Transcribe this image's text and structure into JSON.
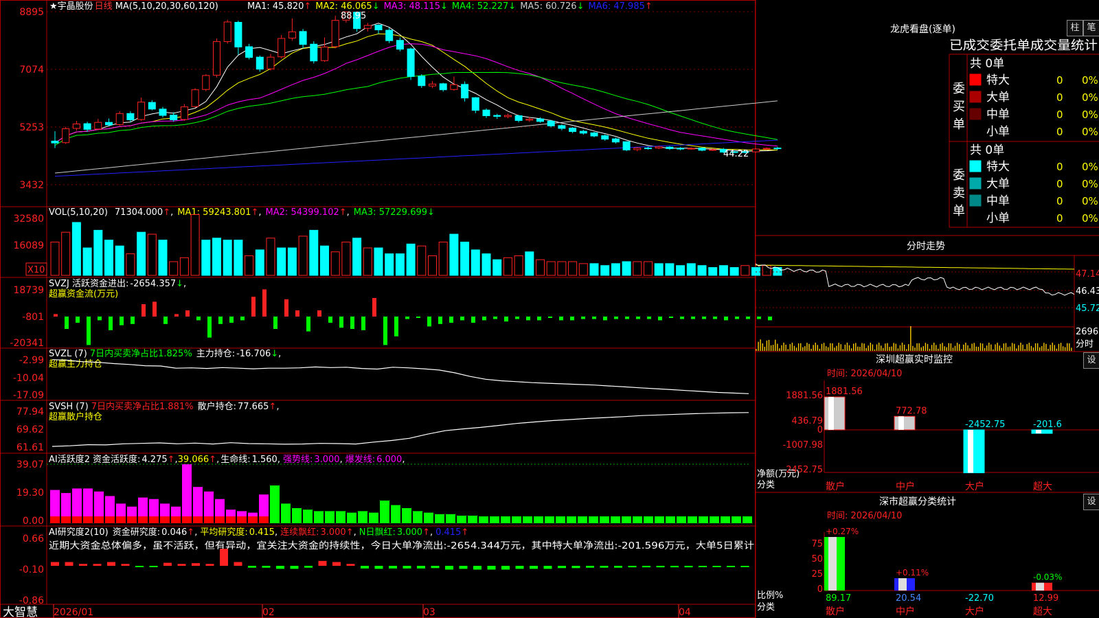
{
  "app": {
    "brand": "大智慧",
    "stock_name": "宇晶股份",
    "period": "日线"
  },
  "main_panel": {
    "ma_label": "MA(5,10,20,30,60,120)",
    "ma_values": [
      {
        "name": "MA1:",
        "value": "45.820",
        "arrow": "↑",
        "color": "#ffffff"
      },
      {
        "name": "MA2:",
        "value": "46.065",
        "arrow": "↓",
        "color": "#ffff00"
      },
      {
        "name": "MA3:",
        "value": "48.115",
        "arrow": "↓",
        "color": "#ff00ff"
      },
      {
        "name": "MA4:",
        "value": "52.227",
        "arrow": "↓",
        "color": "#00ff00"
      },
      {
        "name": "MA5:",
        "value": "60.726",
        "arrow": "↓",
        "color": "#cccccc"
      },
      {
        "name": "MA6:",
        "value": "47.985",
        "arrow": "↑",
        "color": "#2222ff"
      }
    ],
    "y_ticks": [
      "8895",
      "7074",
      "5253",
      "3432"
    ],
    "high_label": "88.95",
    "low_label": "44.22"
  },
  "vol_panel": {
    "label": "VOL(5,10,20)",
    "value": "71304.000",
    "ma1": "59243.801",
    "ma2": "54399.102",
    "ma3": "57229.699",
    "y_ticks": [
      "32580",
      "16089"
    ],
    "unit": "X10"
  },
  "svzj_panel": {
    "label": "SVZJ  活跃资金进出:",
    "value": "-2654.357",
    "sub": "超赢资金流(万元)",
    "y_ticks": [
      "18739",
      "-801",
      "-20341"
    ]
  },
  "svzl_panel": {
    "label": "SVZL (7)",
    "pct": "7日内买卖净占比1.825%",
    "hold_label": "主力持仓:",
    "hold_value": "-16.706",
    "sub": "超赢主力持仓",
    "y_ticks": [
      "-2.99",
      "-10.04",
      "-17.09"
    ]
  },
  "svsh_panel": {
    "label": "SVSH (7)",
    "pct": "7日内买卖净占比1.881%",
    "hold_label": "散户持仓:",
    "hold_value": "77.665",
    "sub": "超赢散户持仓",
    "y_ticks": [
      "77.94",
      "69.62",
      "61.61"
    ]
  },
  "ai_active": {
    "label": "AI活跃度2",
    "v1_label": "资金活跃度:",
    "v1": "4.275",
    "v2": "39.066",
    "v3_label": "生命线:",
    "v3": "1.560",
    "v4_label": "强势线:",
    "v4": "3.000",
    "v5_label": "爆发线:",
    "v5": "6.000",
    "y_ticks": [
      "39.07",
      "19.30",
      "0.00"
    ]
  },
  "ai_research": {
    "label": "AI研究度2(10)",
    "v1_label": "资金研究度:",
    "v1": "0.046",
    "v2_label": "平均研究度:",
    "v2": "0.415",
    "v3_label": "连续飘红:",
    "v3": "3.000",
    "v4_label": "N日飘红:",
    "v4": "3.000",
    "v5": "0.415",
    "comment": "近期大资金总体偏多，虽不活跃，但有异动，宜关注大资金的持续性，今日大单净流出:-2654.344万元，其中特大单净流出:-201.596万元，大单5日累计",
    "y_ticks": [
      "0.66",
      "-0.10",
      "-0.86"
    ]
  },
  "x_axis": [
    "2026/01",
    "02",
    "03",
    "04"
  ],
  "dragon_tiger": {
    "title": "龙虎看盘(逐单)",
    "btn1": "柱",
    "btn2": "笔",
    "header": "已成交委托单成交量统计",
    "buy": {
      "side_label": "委买单",
      "total": "共 0单",
      "rows": [
        {
          "name": "特大",
          "count": "0",
          "pct": "0%",
          "color": "#ff0000"
        },
        {
          "name": "大单",
          "count": "0",
          "pct": "0%",
          "color": "#aa0000"
        },
        {
          "name": "中单",
          "count": "0",
          "pct": "0%",
          "color": "#660000"
        },
        {
          "name": "小单",
          "count": "0",
          "pct": "0%",
          "color": "#000000"
        }
      ]
    },
    "sell": {
      "side_label": "委卖单",
      "total": "共 0单",
      "rows": [
        {
          "name": "特大",
          "count": "0",
          "pct": "0%",
          "color": "#00ffff"
        },
        {
          "name": "大单",
          "count": "0",
          "pct": "0%",
          "color": "#00aaaa"
        },
        {
          "name": "中单",
          "count": "0",
          "pct": "0%",
          "color": "#008888"
        },
        {
          "name": "小单",
          "count": "0",
          "pct": "0%",
          "color": "#000000"
        }
      ]
    }
  },
  "intraday": {
    "title": "分时走势",
    "y_ticks": [
      "47.14",
      "46.43",
      "45.72"
    ],
    "vol_tick": "2696",
    "vol_unit": "分时"
  },
  "sz_monitor": {
    "title": "深圳超赢实时监控",
    "btn": "设",
    "time_label": "时间: 2026/04/10",
    "y_ticks": [
      "1881.56",
      "436.79",
      "0",
      "-1007.98",
      "-2452.75"
    ],
    "unit_label": "净额(万元)",
    "cat_label": "分类",
    "categories": [
      "散户",
      "中户",
      "大户",
      "超大"
    ],
    "values": [
      1881.56,
      772.78,
      -2452.75,
      -201.6
    ],
    "value_labels": [
      "1881.56",
      "772.78",
      "-2452.75",
      "-201.6"
    ]
  },
  "sz_class": {
    "title": "深市超赢分类统计",
    "btn": "设",
    "time_label": "时间: 2026/04/10",
    "y_ticks": [
      "75",
      "50",
      "25",
      "0"
    ],
    "unit_label": "比例%",
    "cat_label": "分类",
    "categories": [
      "散户",
      "中户",
      "大户",
      "超大"
    ],
    "top_labels": [
      "+0.27%",
      "+0.11%",
      "",
      "-0.03%"
    ],
    "bottom_values": [
      "89.17",
      "20.54",
      "-22.70",
      "12.99"
    ],
    "bar_pcts": [
      89.17,
      20.54,
      0,
      12.99
    ]
  },
  "chart_data": [
    {
      "type": "candlestick",
      "title": "宇晶股份 日线",
      "x": [
        "2026/01",
        "02",
        "03",
        "04"
      ],
      "ylim": [
        3432,
        8895
      ],
      "annotations": {
        "high": 88.95,
        "low": 44.22
      },
      "ma_series": [
        {
          "name": "MA1",
          "value": 45.82
        },
        {
          "name": "MA2",
          "value": 46.065
        },
        {
          "name": "MA3",
          "value": 48.115
        },
        {
          "name": "MA4",
          "value": 52.227
        },
        {
          "name": "MA5",
          "value": 60.726
        },
        {
          "name": "MA6",
          "value": 47.985
        }
      ],
      "candles": [
        [
          48.1,
          47.5,
          51.2,
          45.9
        ],
        [
          47.6,
          52.0,
          52.6,
          47.2
        ],
        [
          52.1,
          53.5,
          54.5,
          51.4
        ],
        [
          53.6,
          51.8,
          54.2,
          51.0
        ],
        [
          51.9,
          54.0,
          55.1,
          51.6
        ],
        [
          54.0,
          53.2,
          55.2,
          52.8
        ],
        [
          53.3,
          56.8,
          57.5,
          53.0
        ],
        [
          56.8,
          54.8,
          57.5,
          54.1
        ],
        [
          54.9,
          60.4,
          61.8,
          54.5
        ],
        [
          60.3,
          58.2,
          61.0,
          57.8
        ],
        [
          58.2,
          56.2,
          58.9,
          55.6
        ],
        [
          56.3,
          54.8,
          57.2,
          54.2
        ],
        [
          54.9,
          58.9,
          59.8,
          54.5
        ],
        [
          59.0,
          64.3,
          64.8,
          58.7
        ],
        [
          64.4,
          68.8,
          69.2,
          63.9
        ],
        [
          68.9,
          79.5,
          80.5,
          68.2
        ],
        [
          79.5,
          85.7,
          86.4,
          78.9
        ],
        [
          85.6,
          77.8,
          86.1,
          75.4
        ],
        [
          77.9,
          74.5,
          78.8,
          73.9
        ],
        [
          74.6,
          70.8,
          75.1,
          70.0
        ],
        [
          70.9,
          74.6,
          75.6,
          70.4
        ],
        [
          74.7,
          80.5,
          81.6,
          74.2
        ],
        [
          80.6,
          82.6,
          86.8,
          79.8
        ],
        [
          82.7,
          78.6,
          83.5,
          77.4
        ],
        [
          78.7,
          73.4,
          79.6,
          72.6
        ],
        [
          73.5,
          77.8,
          80.8,
          73.1
        ],
        [
          77.9,
          86.2,
          87.7,
          77.4
        ],
        [
          86.3,
          88.9,
          88.95,
          85.5
        ],
        [
          88.8,
          83.6,
          88.9,
          82.6
        ],
        [
          83.7,
          84.6,
          85.4,
          82.7
        ],
        [
          84.7,
          83.2,
          85.0,
          81.9
        ],
        [
          83.1,
          79.8,
          83.9,
          79.0
        ],
        [
          79.9,
          77.1,
          80.8,
          76.4
        ],
        [
          77.2,
          68.5,
          77.6,
          67.4
        ],
        [
          68.6,
          65.6,
          69.2,
          64.9
        ],
        [
          65.5,
          66.1,
          67.0,
          64.8
        ],
        [
          66.2,
          64.3,
          66.5,
          63.7
        ],
        [
          64.4,
          65.9,
          68.5,
          64.0
        ],
        [
          66.0,
          61.7,
          66.9,
          60.6
        ],
        [
          61.8,
          57.8,
          62.0,
          56.9
        ],
        [
          57.9,
          56.1,
          58.4,
          55.4
        ],
        [
          56.2,
          55.9,
          56.7,
          55.1
        ],
        [
          55.8,
          56.2,
          56.8,
          55.3
        ],
        [
          56.1,
          54.6,
          56.4,
          54.0
        ],
        [
          54.7,
          55.0,
          55.7,
          54.2
        ],
        [
          55.1,
          54.3,
          55.6,
          53.9
        ],
        [
          54.4,
          52.9,
          54.8,
          52.4
        ],
        [
          53.0,
          52.1,
          53.4,
          51.5
        ],
        [
          52.2,
          51.1,
          52.5,
          50.6
        ],
        [
          51.2,
          50.6,
          51.7,
          50.1
        ],
        [
          50.7,
          49.7,
          51.0,
          49.3
        ],
        [
          49.8,
          48.7,
          50.2,
          48.2
        ],
        [
          48.8,
          47.8,
          49.2,
          47.3
        ],
        [
          47.9,
          45.3,
          48.0,
          44.9
        ],
        [
          45.4,
          45.9,
          46.2,
          44.9
        ],
        [
          45.9,
          45.8,
          46.3,
          45.4
        ],
        [
          45.9,
          46.3,
          46.6,
          45.6
        ],
        [
          46.2,
          45.7,
          46.5,
          45.3
        ],
        [
          45.8,
          45.6,
          46.2,
          45.2
        ],
        [
          45.7,
          45.8,
          46.1,
          45.4
        ],
        [
          45.9,
          45.2,
          46.1,
          44.9
        ],
        [
          45.3,
          45.4,
          45.8,
          45.0
        ],
        [
          45.5,
          44.6,
          45.9,
          44.3
        ],
        [
          44.7,
          44.6,
          45.0,
          44.3
        ],
        [
          44.7,
          44.6,
          45.1,
          44.22
        ],
        [
          44.7,
          45.6,
          45.8,
          44.5
        ],
        [
          45.7,
          45.8,
          46.1,
          45.3
        ],
        [
          45.9,
          45.8,
          46.3,
          45.4
        ]
      ]
    },
    {
      "type": "bar",
      "title": "VOL(5,10,20)",
      "ylim": [
        0,
        32580
      ],
      "values": [
        17,
        22,
        27,
        14,
        23,
        18,
        15,
        11,
        22,
        21,
        18,
        7,
        9,
        31,
        18,
        19,
        18,
        18,
        10,
        13,
        19,
        14,
        14,
        20,
        23,
        15,
        12,
        17,
        19,
        14,
        14,
        11,
        11,
        16,
        15,
        10,
        17,
        21,
        17,
        13,
        11,
        8,
        9,
        10,
        12,
        8,
        7,
        7,
        7,
        6,
        6,
        5,
        6,
        7,
        7,
        7,
        6,
        6,
        5,
        6,
        5,
        4,
        5,
        4,
        5,
        4,
        5,
        4
      ],
      "colors": [
        "u",
        "u",
        "c",
        "c",
        "c",
        "c",
        "c",
        "u",
        "c",
        "u",
        "c",
        "u",
        "u",
        "u",
        "c",
        "c",
        "c",
        "c",
        "u",
        "c",
        "u",
        "c",
        "c",
        "u",
        "c",
        "c",
        "u",
        "u",
        "c",
        "u",
        "c",
        "c",
        "c",
        "c",
        "u",
        "u",
        "u",
        "c",
        "c",
        "c",
        "c",
        "c",
        "u",
        "u",
        "c",
        "u",
        "u",
        "u",
        "u",
        "u",
        "c",
        "c",
        "c",
        "c",
        "u",
        "u",
        "c",
        "c",
        "c",
        "c",
        "c",
        "c",
        "c",
        "c",
        "u",
        "c",
        "u",
        "c"
      ]
    },
    {
      "type": "bar",
      "title": "SVZJ 活跃资金进出",
      "ylim": [
        -20341,
        18739
      ],
      "values": [
        0.2,
        -1,
        -0.5,
        -2.3,
        -0.3,
        -1.1,
        -0.7,
        -0.6,
        1.0,
        1.2,
        -0.6,
        0.2,
        0.5,
        -0.3,
        -1.7,
        -0.6,
        -0.5,
        -0.3,
        1.6,
        2.2,
        -1.0,
        1.4,
        0.5,
        -1.2,
        0.5,
        -0.5,
        -0.9,
        -1.0,
        -1.1,
        1.5,
        -2.3,
        -1.6,
        -0.2,
        -0.1,
        -0.8,
        -0.6,
        -0.5,
        -0.3,
        -0.5,
        -0.3,
        -0.2,
        -0.4,
        -0.2,
        -0.3,
        -0.3,
        -0.1,
        -0.3,
        -0.3,
        -0.2,
        -0.2,
        -0.3,
        -0.2,
        -0.2,
        -0.2,
        -0.2,
        -0.3,
        -0.1,
        -0.2,
        -0.2,
        -0.2,
        -0.2,
        -0.3,
        -0.2,
        -0.2,
        -0.2,
        -0.3
      ]
    },
    {
      "type": "line",
      "title": "SVZL 主力持仓",
      "ylim": [
        -17.09,
        -2.99
      ],
      "values": [
        -5.6,
        -5.8,
        -6.3,
        -6.5,
        -6.9,
        -7.2,
        -7.6,
        -7.7,
        -8.4,
        -8.3,
        -8.5,
        -8.2,
        -8.4,
        -8.6,
        -8.4,
        -8.4,
        -8.3,
        -8.0,
        -8.2,
        -8.1,
        -8.5,
        -8.7,
        -8.1,
        -8.3,
        -8.6,
        -9.0,
        -9.9,
        -11.1,
        -12.0,
        -12.5,
        -12.8,
        -13.1,
        -13.3,
        -13.5,
        -13.7,
        -13.9,
        -14.2,
        -14.5,
        -14.8,
        -15.1,
        -15.4,
        -15.7,
        -16.0,
        -16.3,
        -16.5,
        -16.7
      ]
    },
    {
      "type": "line",
      "title": "SVSH 散户持仓",
      "ylim": [
        61.61,
        77.94
      ],
      "values": [
        62.2,
        62.5,
        63.0,
        62.9,
        63.4,
        63.6,
        63.8,
        63.4,
        63.7,
        63.3,
        63.9,
        63.5,
        63.4,
        63.2,
        63.3,
        63.6,
        63.5,
        63.3,
        64.2,
        64.9,
        65.9,
        67.8,
        69.4,
        70.2,
        70.9,
        71.8,
        72.7,
        73.4,
        74.0,
        74.5,
        75.0,
        75.4,
        75.8,
        76.3,
        76.6,
        76.9,
        77.2,
        77.4,
        77.6,
        77.7
      ]
    },
    {
      "type": "bar",
      "title": "AI活跃度2",
      "ylim": [
        0,
        39.07
      ],
      "values": [
        22,
        20,
        23,
        23,
        21,
        18,
        13,
        11,
        17,
        16,
        13,
        11,
        39,
        24,
        21,
        16,
        9,
        8,
        7,
        19,
        25,
        13,
        10,
        9,
        8,
        8,
        8,
        7,
        8,
        7,
        15,
        12,
        10,
        8,
        7,
        6,
        6,
        5,
        5,
        4,
        4,
        3,
        3,
        3,
        3,
        3,
        3,
        3,
        3,
        3,
        3,
        3,
        3,
        3,
        3,
        3,
        3,
        3,
        3,
        3,
        3,
        3,
        3,
        3
      ]
    },
    {
      "type": "bar",
      "title": "AI研究度2(10)",
      "ylim": [
        -0.86,
        0.66
      ],
      "values": [
        0.1,
        0.1,
        0.05,
        0.05,
        0.1,
        0.05,
        -0.03,
        -0.03,
        0.08,
        0.05,
        0.07,
        0.05,
        0.45,
        0.1,
        -0.05,
        -0.05,
        -0.08,
        -0.08,
        -0.05,
        0.13,
        0.1,
        0.05,
        -0.07,
        -0.08,
        -0.07,
        -0.07,
        -0.07,
        -0.06,
        -0.1,
        -0.08,
        -0.1,
        -0.1,
        -0.1,
        -0.08,
        -0.08,
        -0.08,
        -0.06,
        -0.06,
        -0.05,
        -0.05,
        -0.05,
        -0.04,
        -0.04,
        -0.04,
        -0.04,
        -0.04,
        -0.03,
        -0.03,
        -0.03,
        -0.03
      ]
    },
    {
      "type": "bar",
      "title": "深圳超赢实时监控",
      "categories": [
        "散户",
        "中户",
        "大户",
        "超大"
      ],
      "values": [
        1881.56,
        772.78,
        -2452.75,
        -201.6
      ],
      "ylabel": "净额(万元)"
    },
    {
      "type": "bar",
      "title": "深市超赢分类统计",
      "categories": [
        "散户",
        "中户",
        "大户",
        "超大"
      ],
      "values": [
        89.17,
        20.54,
        -22.7,
        12.99
      ],
      "ylabel": "比例%"
    }
  ]
}
